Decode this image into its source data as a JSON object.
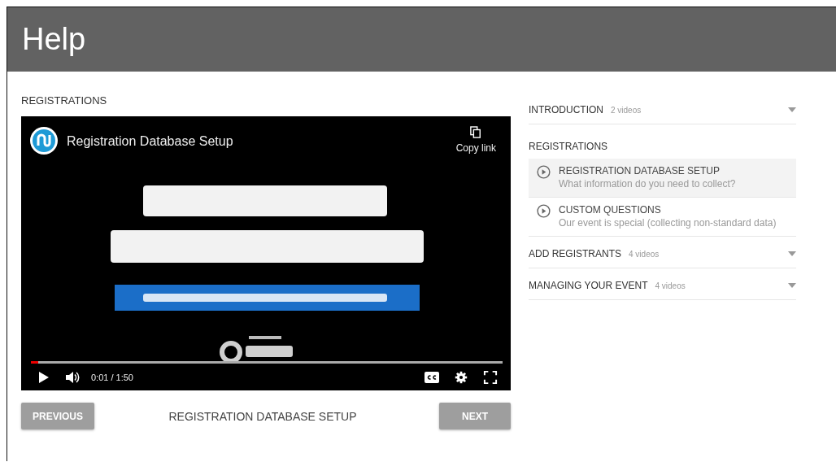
{
  "header": {
    "title": "Help"
  },
  "section_title": "REGISTRATIONS",
  "player": {
    "title": "Registration Database Setup",
    "copy_label": "Copy link",
    "time": "0:01 / 1:50",
    "level": 0.015
  },
  "nav": {
    "previous": "PREVIOUS",
    "current": "REGISTRATION DATABASE SETUP",
    "next": "NEXT"
  },
  "sections": [
    {
      "title": "INTRODUCTION",
      "count": "2 videos",
      "expanded": false
    },
    {
      "title": "REGISTRATIONS",
      "expanded": true,
      "videos": [
        {
          "title": "REGISTRATION DATABASE SETUP",
          "subtitle": "What information do you need to collect?",
          "selected": true
        },
        {
          "title": "CUSTOM QUESTIONS",
          "subtitle": "Our event is special (collecting non-standard data)",
          "selected": false
        }
      ]
    },
    {
      "title": "ADD REGISTRANTS",
      "count": "4 videos",
      "expanded": false
    },
    {
      "title": "MANAGING YOUR EVENT",
      "count": "4 videos",
      "expanded": false
    }
  ]
}
